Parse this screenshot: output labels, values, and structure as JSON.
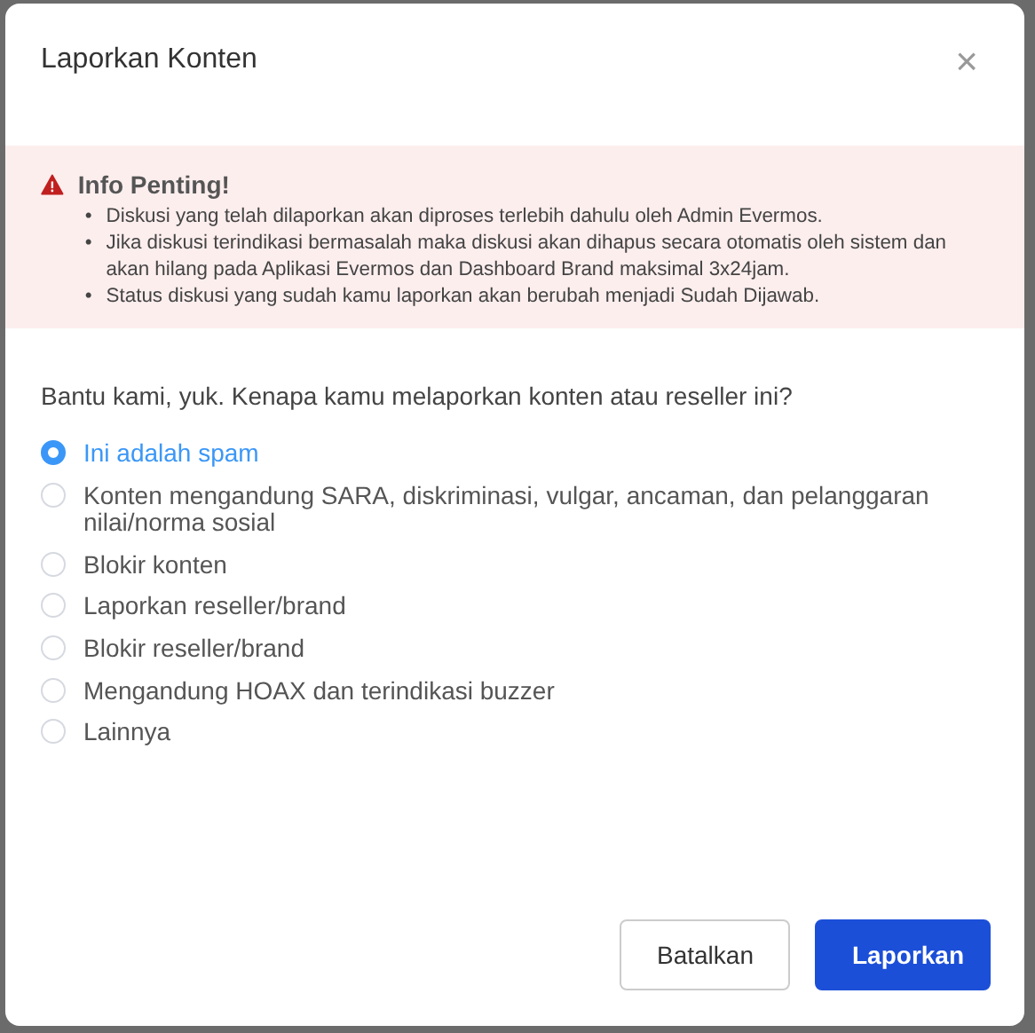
{
  "dialog": {
    "title": "Laporkan Konten",
    "close": "×"
  },
  "alert": {
    "title": "Info Penting!",
    "items": [
      {
        "bullet": "•",
        "text": "Diskusi yang telah dilaporkan akan diproses terlebih dahulu oleh Admin Evermos."
      },
      {
        "bullet": "•",
        "text": "Jika diskusi terindikasi bermasalah maka diskusi akan dihapus secara otomatis oleh sistem dan akan hilang pada Aplikasi Evermos dan Dashboard Brand maksimal 3x24jam."
      },
      {
        "bullet": "•",
        "text": "Status diskusi yang sudah kamu laporkan akan berubah menjadi Sudah Dijawab."
      }
    ]
  },
  "question": "Bantu kami, yuk. Kenapa kamu melaporkan konten atau reseller ini?",
  "options": [
    {
      "label": "Ini adalah spam",
      "selected": true
    },
    {
      "label": "Konten mengandung SARA, diskriminasi, vulgar, ancaman, dan pelanggaran nilai/norma sosial",
      "selected": false
    },
    {
      "label": "Blokir konten",
      "selected": false
    },
    {
      "label": "Laporkan reseller/brand",
      "selected": false
    },
    {
      "label": "Blokir reseller/brand",
      "selected": false
    },
    {
      "label": "Mengandung HOAX dan terindikasi buzzer",
      "selected": false
    },
    {
      "label": "Lainnya",
      "selected": false
    }
  ],
  "buttons": [
    {
      "label": "Batalkan",
      "kind": "secondary"
    },
    {
      "label": "Laporkan",
      "kind": "primary"
    }
  ]
}
